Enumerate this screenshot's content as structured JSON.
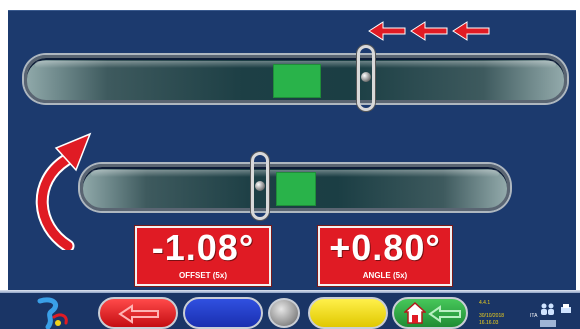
{
  "readouts": {
    "offset": {
      "value": "-1.08°",
      "label": "OFFSET (5x)"
    },
    "angle": {
      "value": "+0.80°",
      "label": "ANGLE (5x)"
    }
  },
  "indicators": {
    "direction_arrows": {
      "count": 3,
      "direction": "left",
      "color": "#e01b24"
    },
    "curved_arrow": {
      "direction": "clockwise",
      "color": "#e01b24"
    }
  },
  "bottom_bar": {
    "buttons": [
      {
        "name": "back",
        "icon": "left-arrow-icon",
        "color": "#d11a1f"
      },
      {
        "name": "blank-blue",
        "color": "#2438c8"
      },
      {
        "name": "center-gray",
        "color": "#9a9a9a"
      },
      {
        "name": "blank-yellow",
        "color": "#f2e010"
      },
      {
        "name": "home-back",
        "icon": "home-icon",
        "color": "#2ea44a"
      }
    ],
    "status": {
      "version": "4.4.1",
      "date": "30/10/2018",
      "time": "16.16.03",
      "language": "ITA"
    }
  },
  "colors": {
    "background": "#1c3a6e",
    "target_zone": "#29b34a",
    "alert": "#e01b24"
  }
}
